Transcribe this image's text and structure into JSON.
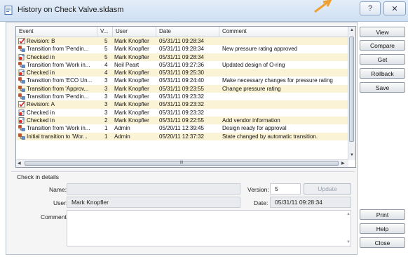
{
  "window": {
    "title": "History on Check Valve.sldasm",
    "help_glyph": "?",
    "close_glyph": "✕"
  },
  "columns": [
    "Event",
    "V...",
    "User",
    "Date",
    "Comment"
  ],
  "rows": [
    {
      "icon": "revision-icon",
      "event": "Revision: B",
      "version": "5",
      "user": "Mark Knopfler",
      "date": "05/31/11 09:28:34",
      "comment": "",
      "alt": true
    },
    {
      "icon": "transition-icon",
      "event": "Transition from 'Pendin...",
      "version": "5",
      "user": "Mark Knopfler",
      "date": "05/31/11 09:28:34",
      "comment": "New pressure rating approved",
      "alt": false
    },
    {
      "icon": "checkin-icon",
      "event": "Checked in",
      "version": "5",
      "user": "Mark Knopfler",
      "date": "05/31/11 09:28:34",
      "comment": "",
      "alt": true
    },
    {
      "icon": "transition-icon",
      "event": "Transition from 'Work in...",
      "version": "4",
      "user": "Neil Peart",
      "date": "05/31/11 09:27:36",
      "comment": "Updated design of O-ring",
      "alt": false
    },
    {
      "icon": "checkin-icon",
      "event": "Checked in",
      "version": "4",
      "user": "Mark Knopfler",
      "date": "05/31/11 09:25:30",
      "comment": "",
      "alt": true
    },
    {
      "icon": "transition-icon",
      "event": "Transition from 'ECO Un...",
      "version": "3",
      "user": "Mark Knopfler",
      "date": "05/31/11 09:24:40",
      "comment": "Make necessary changes for pressure rating",
      "alt": false
    },
    {
      "icon": "transition-icon",
      "event": "Transition from 'Approv...",
      "version": "3",
      "user": "Mark Knopfler",
      "date": "05/31/11 09:23:55",
      "comment": "Change pressure rating",
      "alt": true
    },
    {
      "icon": "transition-icon",
      "event": "Transition from 'Pendin...",
      "version": "3",
      "user": "Mark Knopfler",
      "date": "05/31/11 09:23:32",
      "comment": "",
      "alt": false
    },
    {
      "icon": "revision-icon",
      "event": "Revision: A",
      "version": "3",
      "user": "Mark Knopfler",
      "date": "05/31/11 09:23:32",
      "comment": "",
      "alt": true
    },
    {
      "icon": "checkin-icon",
      "event": "Checked in",
      "version": "3",
      "user": "Mark Knopfler",
      "date": "05/31/11 09:23:32",
      "comment": "",
      "alt": false
    },
    {
      "icon": "checkin-icon",
      "event": "Checked in",
      "version": "2",
      "user": "Mark Knopfler",
      "date": "05/31/11 09:22:55",
      "comment": "Add vendor information",
      "alt": true
    },
    {
      "icon": "transition-icon",
      "event": "Transition from 'Work in...",
      "version": "1",
      "user": "Admin",
      "date": "05/20/11 12:39:45",
      "comment": "Design ready for approval",
      "alt": false
    },
    {
      "icon": "transition-icon",
      "event": "Initial transition to 'Wor...",
      "version": "1",
      "user": "Admin",
      "date": "05/20/11 12:37:32",
      "comment": "State changed by automatic transition.",
      "alt": true
    }
  ],
  "scroll": {
    "h_grip": "III"
  },
  "buttons": {
    "view": "View",
    "compare": "Compare",
    "get": "Get",
    "rollback": "Rollback",
    "save": "Save",
    "print": "Print",
    "help": "Help",
    "close": "Close"
  },
  "details": {
    "group_label": "Check in details",
    "name_label": "Name:",
    "name_value": "",
    "version_label": "Version:",
    "version_value": "5",
    "update_label": "Update",
    "user_label": "User:",
    "user_value": "Mark Knopfler",
    "date_label": "Date:",
    "date_value": "05/31/11 09:28:34",
    "comment_label": "Comment:",
    "comment_value": ""
  },
  "colors": {
    "row_alt": "#fbf3d6",
    "accent_arrow": "#f0a030"
  }
}
